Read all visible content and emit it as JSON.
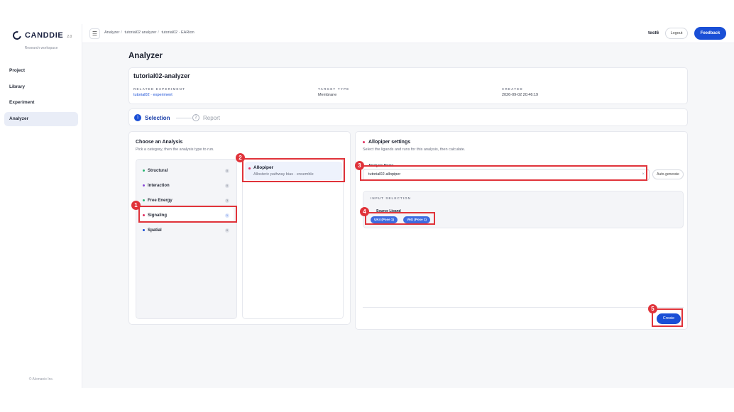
{
  "brand": {
    "name": "CANDDIE",
    "version": "2.0",
    "subtitle": "Research workspace"
  },
  "sidebar": {
    "items": [
      {
        "label": "Project"
      },
      {
        "label": "Library"
      },
      {
        "label": "Experiment"
      },
      {
        "label": "Analyzer",
        "active": true
      }
    ],
    "copyright": "© Alcmanix Inc."
  },
  "topbar": {
    "breadcrumb": [
      "Analyzer",
      "tutorial02 analyzer",
      "tutorial02 · EARion"
    ],
    "user": "test6",
    "logout_label": "Logout",
    "feedback_label": "Feedback"
  },
  "page": {
    "title": "Analyzer"
  },
  "info": {
    "title": "tutorial02-analyzer",
    "related_label": "RELATED EXPERIMENT",
    "related_value": "tutorial02 · experiment",
    "target_label": "TARGET TYPE",
    "target_value": "Membrane",
    "created_label": "CREATED",
    "created_value": "2026-09-02 20:46:19"
  },
  "stepper": {
    "steps": [
      {
        "num": "1",
        "label": "Selection",
        "active": true
      },
      {
        "num": "2",
        "label": "Report",
        "active": false
      }
    ]
  },
  "analysis": {
    "title": "Choose an Analysis",
    "subtitle": "Pick a category, then the analysis type to run.",
    "categories": [
      {
        "label": "Structural",
        "count": "0",
        "color": "#2bb673"
      },
      {
        "label": "Interaction",
        "count": "0",
        "color": "#8a4bd6"
      },
      {
        "label": "Free Energy",
        "count": "3",
        "color": "#2bb673"
      },
      {
        "label": "Signaling",
        "count": "1",
        "color": "#e03060"
      },
      {
        "label": "Spatial",
        "count": "0",
        "color": "#1a4fd6"
      }
    ],
    "type": {
      "title": "Allopiper",
      "subtitle": "Allosteric pathway bias · ensemble"
    }
  },
  "settings": {
    "title": "Allopiper settings",
    "subtitle": "Select the ligands and runs for this analysis, then calculate.",
    "name_label": "Analysis Name",
    "name_value": "tutorial02-allopiper",
    "autogen_label": "Auto-generate",
    "input_selection_label": "INPUT SELECTION",
    "ligand_label": "Source Ligand",
    "ligands": [
      "UK4 (Pose 1)",
      "V6G (Pose 1)"
    ],
    "create_label": "Create"
  },
  "markers": [
    "1",
    "2",
    "3",
    "4",
    "5"
  ],
  "colors": {
    "accent": "#1a4fd6",
    "highlight": "#e0333a",
    "signal": "#e03060"
  }
}
